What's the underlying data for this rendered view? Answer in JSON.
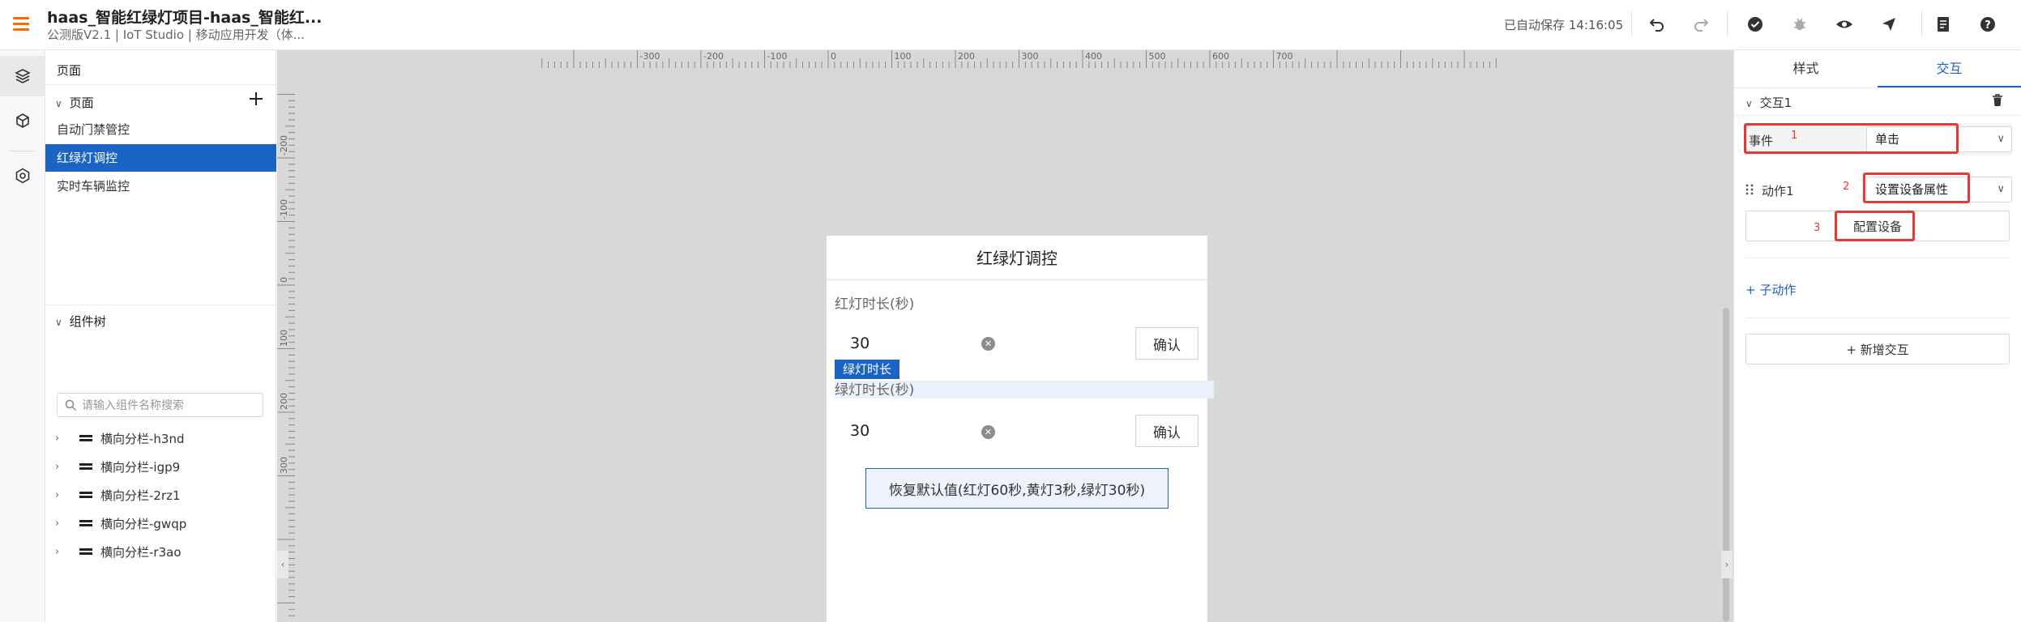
{
  "header": {
    "title": "haas_智能红绿灯项目-haas_智能红...",
    "subtitle": "公测版V2.1 | IoT Studio | 移动应用开发（体...",
    "autosave": "已自动保存 14:16:05",
    "tools": [
      "undo-icon",
      "redo-icon",
      "check-circle-icon",
      "bug-icon",
      "eye-icon",
      "send-icon",
      "document-icon",
      "help-icon"
    ],
    "accent": "#ff6a00"
  },
  "rail": {
    "items": [
      "layers-icon",
      "cube-icon",
      "settings-icon"
    ]
  },
  "pages": {
    "header": "页面",
    "section": "页面",
    "items": [
      "自动门禁管控",
      "红绿灯调控",
      "实时车辆监控"
    ],
    "active_index": 1
  },
  "component_tree": {
    "header": "组件树",
    "search_placeholder": "请输入组件名称搜索",
    "items": [
      "横向分栏-h3nd",
      "横向分栏-igp9",
      "横向分栏-2rz1",
      "横向分栏-gwqp",
      "横向分栏-r3ao"
    ]
  },
  "ruler": {
    "top_labels": [
      "-300",
      "-200",
      "-100",
      "0",
      "100",
      "200",
      "300",
      "400",
      "500",
      "600",
      "700"
    ],
    "left_labels": [
      "-200",
      "-100",
      "0",
      "100",
      "200",
      "300"
    ]
  },
  "phone": {
    "title": "红绿灯调控",
    "red_label": "红灯时长(秒)",
    "red_value": "30",
    "red_confirm": "确认",
    "selected_tag": "绿灯时长",
    "green_label": "绿灯时长(秒)",
    "green_value": "30",
    "green_confirm": "确认",
    "restore_button": "恢复默认值(红灯60秒,黄灯3秒,绿灯30秒)",
    "clear_glyph": "✕"
  },
  "right_panel": {
    "tabs": [
      "样式",
      "交互"
    ],
    "active_tab": 1,
    "interaction_title": "交互1",
    "event_label": "事件",
    "event_value": "单击",
    "action_label": "动作1",
    "action_value": "设置设备属性",
    "config_button": "配置设备",
    "sub_action_link": "+ 子动作",
    "add_interaction_button": "+ 新增交互",
    "annotations": [
      "1",
      "2",
      "3"
    ],
    "highlight_color": "#e53935"
  },
  "colors": {
    "primary": "#1b64c4",
    "canvas": "#d8d8d8"
  }
}
